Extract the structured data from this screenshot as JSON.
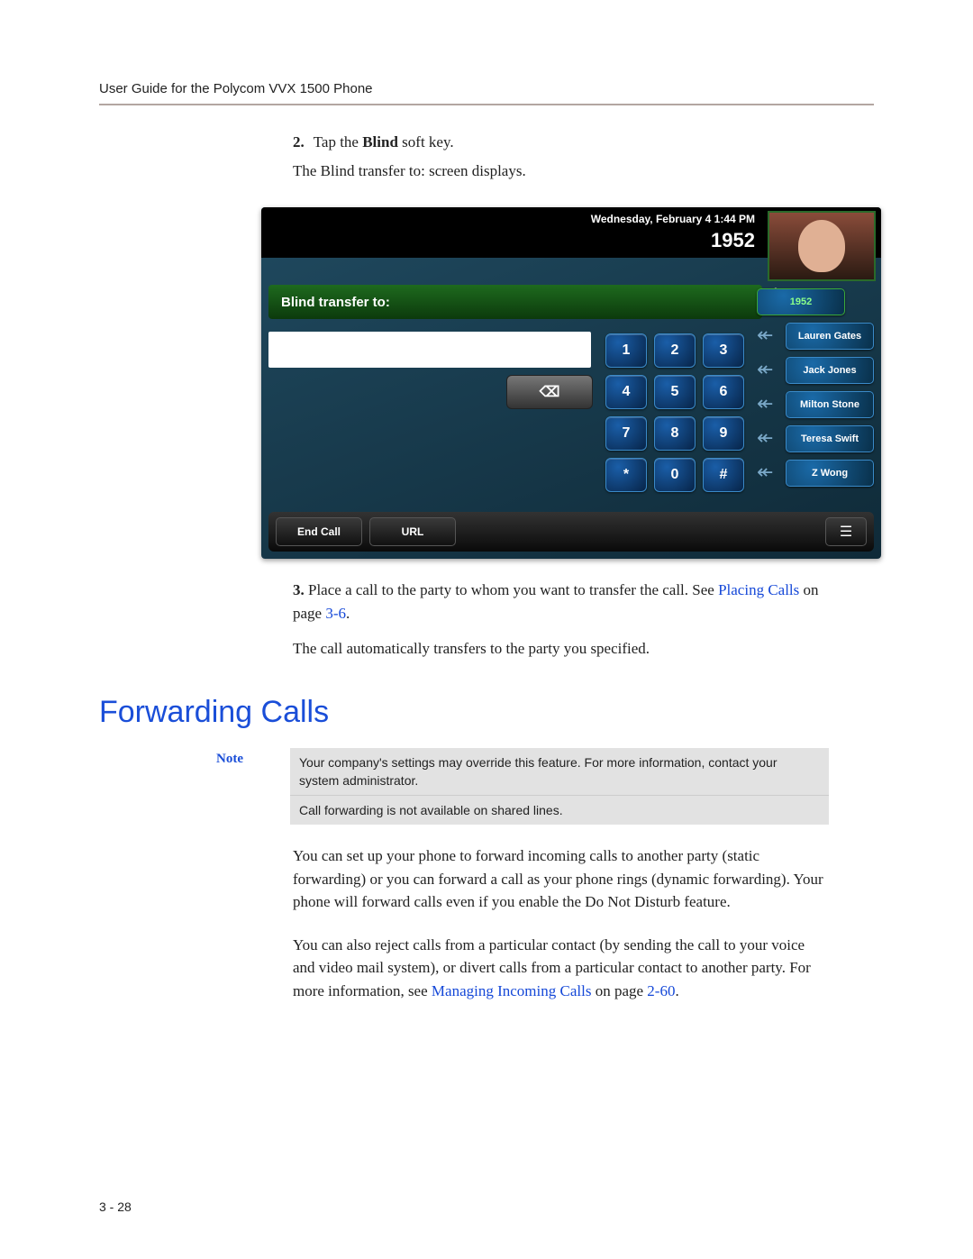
{
  "header": "User Guide for the Polycom VVX 1500 Phone",
  "page_num": "3 - 28",
  "step2": {
    "num": "2.",
    "pre": "Tap the ",
    "bold": "Blind",
    "post": " soft key.",
    "sub": "The Blind transfer to: screen displays."
  },
  "phone": {
    "datetime": "Wednesday, February 4  1:44 PM",
    "extension": "1952",
    "greenbar": "Blind transfer to:",
    "backspace_glyph": "⌫",
    "keys": [
      [
        "1",
        "2",
        "3"
      ],
      [
        "4",
        "5",
        "6"
      ],
      [
        "7",
        "8",
        "9"
      ],
      [
        "*",
        "0",
        "#"
      ]
    ],
    "side": {
      "ext": "1952",
      "contacts": [
        "Lauren Gates",
        "Jack Jones",
        "Milton Stone",
        "Teresa Swift",
        "Z Wong"
      ]
    },
    "soft": {
      "end": "End Call",
      "url": "URL"
    },
    "menu_glyph": "☰"
  },
  "step3": {
    "num": "3.",
    "text_a": "Place a call to the party to whom you want to transfer the call. See ",
    "link": "Placing Calls",
    "text_b": " on page ",
    "pageref": "3-6",
    "post": "."
  },
  "followup": "The call automatically transfers to the party you specified.",
  "section_title": "Forwarding Calls",
  "note": {
    "label": "Note",
    "p1": "Your company's settings may override this feature. For more information, contact your system administrator.",
    "p2": "Call forwarding is not available on shared lines."
  },
  "para1": "You can set up your phone to forward incoming calls to another party (static forwarding) or you can forward a call as your phone rings (dynamic forwarding). Your phone will forward calls even if you enable the Do Not Disturb feature.",
  "para2": {
    "a": "You can also reject calls from a particular contact (by sending the call to your voice and video mail system), or divert calls from a particular contact to another party. For more information, see ",
    "link": "Managing Incoming Calls",
    "b": " on page ",
    "pageref": "2-60",
    "c": "."
  }
}
